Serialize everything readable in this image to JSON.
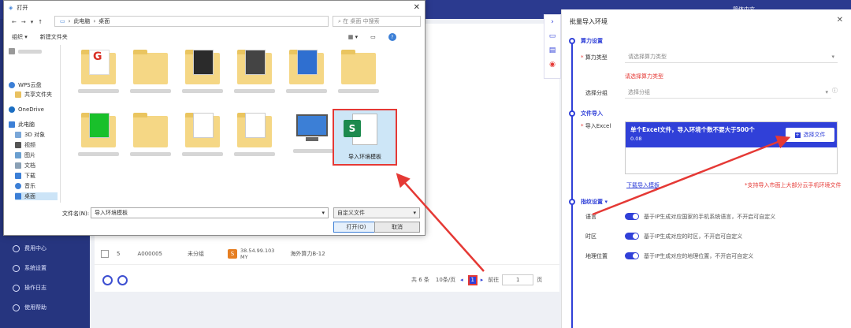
{
  "background": {
    "sidebar": [
      "费用中心",
      "系统设置",
      "操作日志",
      "使用帮助"
    ],
    "top_right": {
      "lang": "简体中文"
    },
    "row": {
      "index": "5",
      "id": "A000005",
      "group": "未分组",
      "badge": "S",
      "ip": "38.54.99.103",
      "ip2": "MY",
      "location": "海外算力B-12"
    },
    "pager": {
      "total": "共 6 条",
      "per_page": "10条/页",
      "page": "1",
      "goto_label": "前往",
      "goto_value": "1",
      "page_unit": "页"
    }
  },
  "panel": {
    "title": "批量导入环境",
    "section_power": "算力设置",
    "power_type_label": "算力类型",
    "power_type_placeholder": "请选择算力类型",
    "power_type_error": "请选择算力类型",
    "group_label": "选择分组",
    "group_placeholder": "选择分组",
    "section_file": "文件导入",
    "excel_label": "导入Excel",
    "upload_title": "单个Excel文件，导入环境个数不要大于500个",
    "upload_sub": "0.08",
    "choose_file": "选择文件",
    "download_template": "下载导入模板",
    "support_note": "*支持导入市面上大部分云手机环境文件",
    "section_fingerprint": "指纹设置",
    "language_label": "语言",
    "language_desc": "基于IP生成对应国家的手机系统语言，不开启可自定义",
    "timezone_label": "时区",
    "timezone_desc": "基于IP生成对应的时区，不开启可自定义",
    "geo_label": "地理位置",
    "geo_desc": "基于IP生成对应的地理位置，不开启可自定义"
  },
  "dialog": {
    "title": "打开",
    "path": [
      "此电脑",
      "桌面"
    ],
    "search_placeholder": "在 桌面 中搜索",
    "organize": "组织",
    "new_folder": "新建文件夹",
    "nav": [
      "WPS云盘",
      "共享文件夹",
      "OneDrive",
      "此电脑",
      "3D 对象",
      "视频",
      "图片",
      "文档",
      "下载",
      "音乐",
      "桌面"
    ],
    "selected_file": "导入环境模板",
    "filename_label": "文件名(N):",
    "filename_value": "导入环境模板",
    "filetype": "自定义文件",
    "open": "打开(O)",
    "cancel": "取消"
  },
  "colors": {
    "accent": "#3040d8",
    "annotation": "#e53935",
    "excel": "#1d8a4e"
  }
}
